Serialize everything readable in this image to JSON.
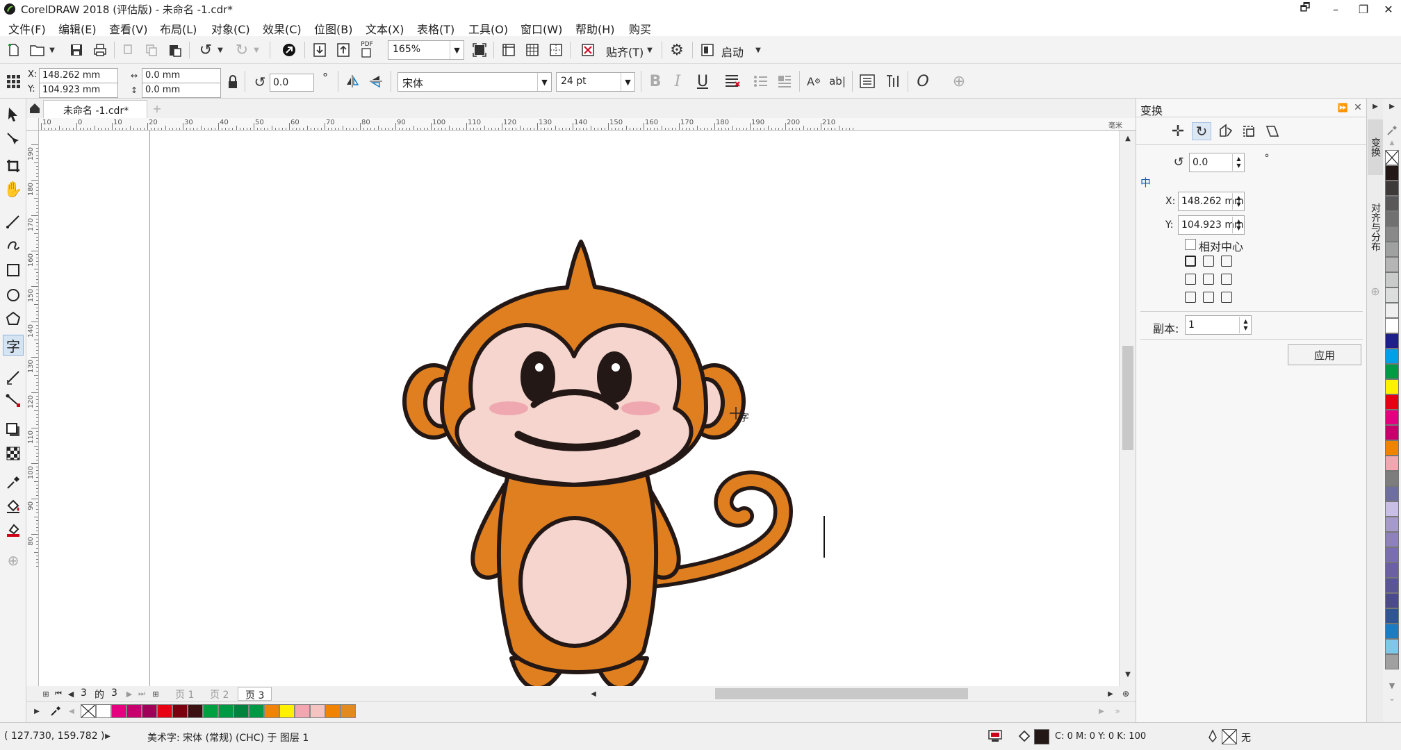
{
  "app": {
    "title": "CorelDRAW 2018 (评估版) - 未命名 -1.cdr*",
    "window_controls": [
      "🗗",
      "–",
      "❐",
      "✕"
    ]
  },
  "menu": [
    "文件(F)",
    "编辑(E)",
    "查看(V)",
    "布局(L)",
    "对象(C)",
    "效果(C)",
    "位图(B)",
    "文本(X)",
    "表格(T)",
    "工具(O)",
    "窗口(W)",
    "帮助(H)",
    "购买"
  ],
  "toolbar": {
    "zoom_value": "165%",
    "snap_label": "贴齐(T)",
    "launch_label": "启动",
    "pdf_label": "PDF"
  },
  "property_bar": {
    "x_label": "X:",
    "x_value": "148.262 mm",
    "y_label": "Y:",
    "y_value": "104.923 mm",
    "width_value": "0.0 mm",
    "height_value": "0.0 mm",
    "rotation_value": "0.0",
    "degree_symbol": "°",
    "font_name": "宋体",
    "font_size": "24 pt"
  },
  "document": {
    "tab_label": "未命名 -1.cdr*",
    "pages": {
      "current": "3",
      "of_label": "的",
      "total": "3",
      "tabs": [
        "页 1",
        "页 2",
        "页 3"
      ],
      "active_index": 2
    }
  },
  "rulers": {
    "h_labels": [
      "10",
      "0",
      "10",
      "20",
      "30",
      "40",
      "50",
      "60",
      "70",
      "80",
      "90",
      "100",
      "110",
      "120",
      "130",
      "140",
      "150",
      "160",
      "170",
      "180",
      "190",
      "200",
      "210"
    ],
    "h_unit": "毫米",
    "v_labels": [
      "190",
      "180",
      "170",
      "160",
      "150",
      "140",
      "130",
      "120",
      "110",
      "100",
      "90",
      "80"
    ]
  },
  "docker": {
    "title": "变换",
    "rotation_value": "0.0",
    "center_label": "中",
    "x_label": "X:",
    "x_value": "148.262 mm",
    "y_label": "Y:",
    "y_value": "104.923 mm",
    "relative_center_label": "相对中心",
    "copies_label": "副本:",
    "copies_value": "1",
    "apply_label": "应用",
    "side_tabs": [
      "变换",
      "对齐与分布"
    ]
  },
  "status": {
    "coords": "( 127.730, 159.782 )",
    "object_info": "美术字: 宋体 (常规) (CHC) 于 图层 1",
    "fill_info": "C: 0 M: 0 Y: 0 K: 100",
    "outline_info": "无"
  },
  "colors": {
    "bottom_palette": [
      "#ffffff",
      "#e4007f",
      "#c8006e",
      "#a0005a",
      "#e60012",
      "#7a0010",
      "#3b1010",
      "#00a040",
      "#009944",
      "#00843d",
      "#009944",
      "#f08300",
      "#fff100",
      "#f2a7b0",
      "#f6c3c3",
      "#f08300",
      "#e38a1e"
    ],
    "right_palette": [
      "#231815",
      "#3e3a39",
      "#595757",
      "#727171",
      "#898989",
      "#9fa0a0",
      "#b5b5b6",
      "#c9caca",
      "#dcdddd",
      "#efefef",
      "#ffffff",
      "#1d2088",
      "#00a0e9",
      "#009944",
      "#fff100",
      "#e60012",
      "#e4007f",
      "#c8006e",
      "#f08300",
      "#f2a7b0",
      "#7d7d7d",
      "#6f6f9f",
      "#c9bfe6",
      "#a59aca",
      "#8f82bc",
      "#7a6eb0",
      "#6b5fa5",
      "#5a5598",
      "#4b4a8a",
      "#2f5597",
      "#1b7cc1",
      "#7fc7e8",
      "#a0a0a0"
    ],
    "monkey_orange": "#e07f20",
    "monkey_face": "#f5d5cd",
    "monkey_outline": "#231815",
    "monkey_blush": "#f0a8b0"
  }
}
